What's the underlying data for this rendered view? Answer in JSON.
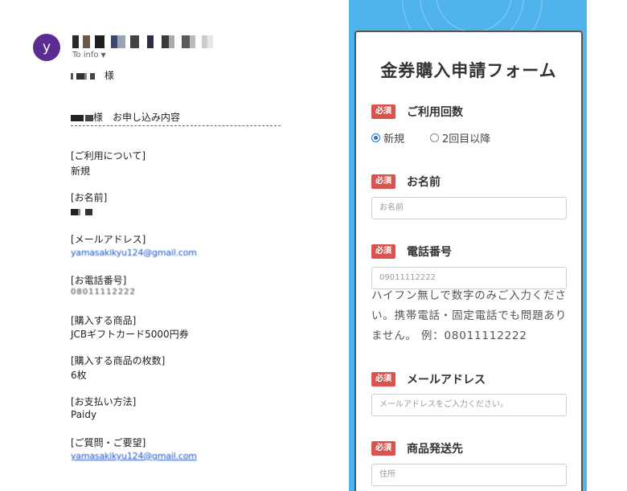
{
  "email": {
    "avatar_letter": "y",
    "to_info": "To info",
    "sama": "様",
    "subject_suffix": "様",
    "subject": "お申し込み内容",
    "rule": "――――――――――――――――――――――――――",
    "sections": [
      {
        "label": "[ご利用について]",
        "value": "新規"
      },
      {
        "label": "[お名前]",
        "value": ""
      },
      {
        "label": "[メールアドレス]",
        "value": "yamasakikyu124@gmail.com"
      },
      {
        "label": "[お電話番号]",
        "value": "08011112222"
      },
      {
        "label": "[購入する商品]",
        "value": "JCBギフトカード5000円券"
      },
      {
        "label": "[購入する商品の枚数]",
        "value": "6枚"
      },
      {
        "label": "[お支払い方法]",
        "value": "Paidy"
      },
      {
        "label": "[ご質問・ご要望]",
        "value": "yamasakikyu124@gmail.com"
      }
    ]
  },
  "form": {
    "title": "金券購入申請フォーム",
    "required": "必須",
    "usage": {
      "label": "ご利用回数",
      "options": [
        "新規",
        "2回目以降"
      ],
      "selected": "新規"
    },
    "name": {
      "label": "お名前",
      "placeholder": "お名前"
    },
    "phone": {
      "label": "電話番号",
      "placeholder": "09011112222",
      "help": "ハイフン無しで数字のみご入力ください。携帯電話・固定電話でも問題ありません。 例：08011112222"
    },
    "email": {
      "label": "メールアドレス",
      "placeholder": "メールアドレスをご入力ください。"
    },
    "address": {
      "label": "商品発送先",
      "placeholder": "住所"
    }
  },
  "colors": {
    "avatar": "#5c2d91",
    "panel": "#4fb3ec",
    "required_badge": "#d9534f",
    "radio_selected": "#1e73d8",
    "link": "#1a55c9"
  }
}
